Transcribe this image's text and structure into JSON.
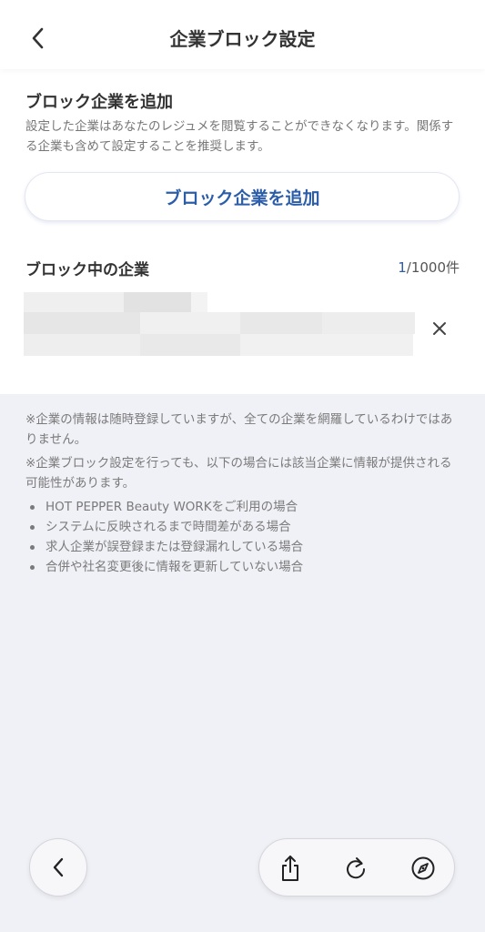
{
  "header": {
    "title": "企業ブロック設定",
    "back_icon": "chevron-left-icon"
  },
  "add_section": {
    "title": "ブロック企業を追加",
    "description": "設定した企業はあなたのレジュメを閲覧することができなくなります。関係する企業も含めて設定することを推奨します。",
    "button_label": "ブロック企業を追加"
  },
  "blocked": {
    "title": "ブロック中の企業",
    "count_current": "1",
    "count_suffix": "/1000件",
    "items": [
      {
        "name": "",
        "remove_icon": "close-icon"
      }
    ]
  },
  "notes": {
    "note1": "※企業の情報は随時登録していますが、全ての企業を網羅しているわけではありません。",
    "note2": "※企業ブロック設定を行っても、以下の場合には該当企業に情報が提供される可能性があります。",
    "bullets": [
      "HOT PEPPER Beauty WORKをご利用の場合",
      "システムに反映されるまで時間差がある場合",
      "求人企業が誤登録または登録漏れしている場合",
      "合併や社名変更後に情報を更新していない場合"
    ]
  },
  "browser_toolbar": {
    "back_icon": "chevron-left-icon",
    "share_icon": "share-icon",
    "reload_icon": "reload-icon",
    "compass_icon": "compass-icon"
  },
  "colors": {
    "accent": "#2c5da8",
    "background": "#f0f1f6",
    "surface": "#ffffff"
  }
}
